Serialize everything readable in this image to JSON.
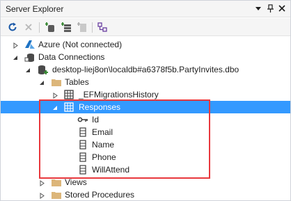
{
  "window": {
    "title": "Server Explorer"
  },
  "title_buttons": {
    "dropdown_glyph": "▼",
    "pin_glyph": "📌",
    "close_glyph": "✕"
  },
  "toolbar": {
    "buttons": [
      {
        "name": "refresh-icon"
      },
      {
        "name": "stop-icon"
      },
      {
        "name": "connect-to-database-icon"
      },
      {
        "name": "connect-to-server-icon"
      },
      {
        "name": "connect-to-sharepoint-icon"
      },
      {
        "name": "filter-icon"
      }
    ]
  },
  "tree": {
    "azure": "Azure (Not connected)",
    "data_connections": "Data Connections",
    "connection": "desktop-liej8on\\localdb#a6378f5b.PartyInvites.dbo",
    "tables": "Tables",
    "ef_history": "_EFMigrationsHistory",
    "responses": "Responses",
    "columns": [
      "Id",
      "Email",
      "Name",
      "Phone",
      "WillAttend"
    ],
    "views": "Views",
    "stored_procedures": "Stored Procedures"
  },
  "colors": {
    "selection": "#3399ff",
    "highlight_box": "#e8383d",
    "folder": "#dcb67a"
  }
}
